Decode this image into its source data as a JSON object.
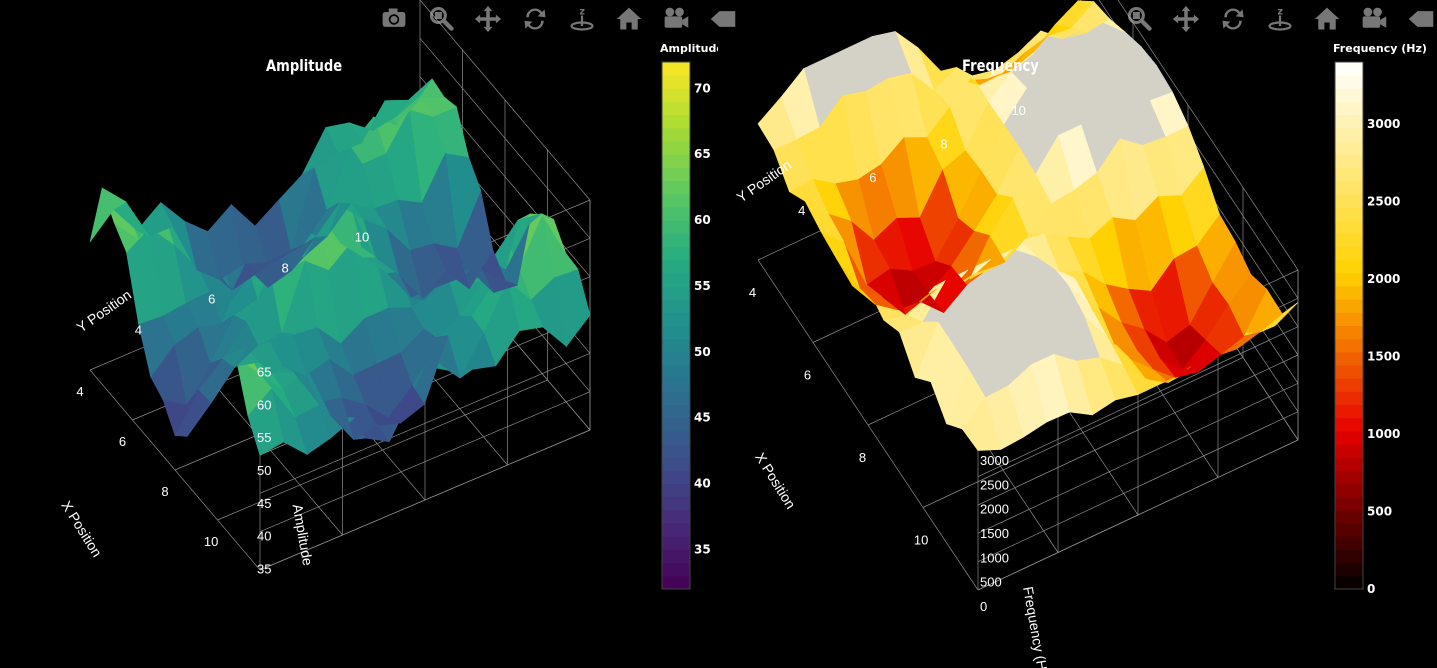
{
  "modebar": {
    "buttons": [
      "camera-icon",
      "zoom-icon",
      "pan-icon",
      "orbit-rotate-icon",
      "turntable-rotate-icon",
      "home-icon",
      "camera-view-icon",
      "hover-toggle-icon"
    ],
    "icon_color": "#777777"
  },
  "chart_data": [
    {
      "type": "surface",
      "title": "Amplitude",
      "xlabel": "X Position",
      "ylabel": "Y Position",
      "zlabel": "Amplitude",
      "x_ticks": [
        "4",
        "6",
        "8",
        "10"
      ],
      "y_ticks": [
        "4",
        "6",
        "8",
        "10"
      ],
      "z_ticks": [
        "35",
        "40",
        "45",
        "50",
        "55",
        "60",
        "65"
      ],
      "colorbar": {
        "title": "Amplitude",
        "range": [
          32,
          72
        ],
        "ticks": [
          "35",
          "40",
          "45",
          "50",
          "55",
          "60",
          "65",
          "70"
        ],
        "colorscale": "viridis"
      }
    },
    {
      "type": "surface",
      "title": "Frequency",
      "xlabel": "X Position",
      "ylabel": "Y Position",
      "zlabel": "Frequency (Hz)",
      "x_ticks": [
        "4",
        "6",
        "8",
        "10"
      ],
      "y_ticks": [
        "4",
        "6",
        "8",
        "10"
      ],
      "z_ticks": [
        "0",
        "500",
        "1000",
        "1500",
        "2000",
        "2500",
        "3000"
      ],
      "colorbar": {
        "title": "Frequency (Hz)",
        "range": [
          0,
          3400
        ],
        "ticks": [
          "0",
          "500",
          "1000",
          "1500",
          "2000",
          "2500",
          "3000"
        ],
        "colorscale": "hot"
      }
    }
  ]
}
